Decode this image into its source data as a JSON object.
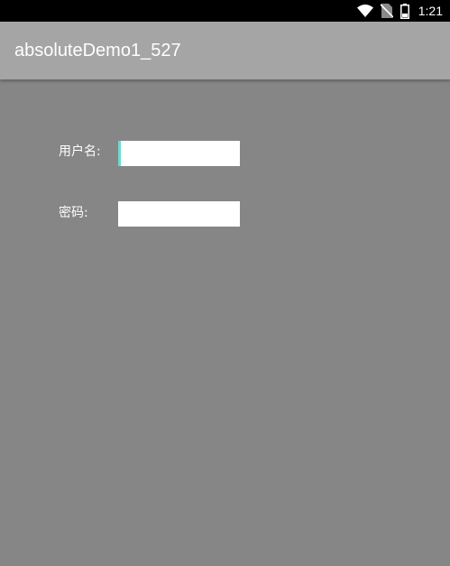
{
  "status_bar": {
    "time": "1:21",
    "icons": [
      "wifi-icon",
      "no-sim-icon",
      "battery-icon"
    ]
  },
  "app_bar": {
    "title": "absoluteDemo1_527",
    "background": "#a5a5a5"
  },
  "form": {
    "username_label": "用户名:",
    "username_value": "",
    "password_label": "密码:",
    "password_value": ""
  },
  "colors": {
    "content_background": "#868686",
    "status_bar": "#000000",
    "cursor_accent": "#6fd8d0"
  }
}
